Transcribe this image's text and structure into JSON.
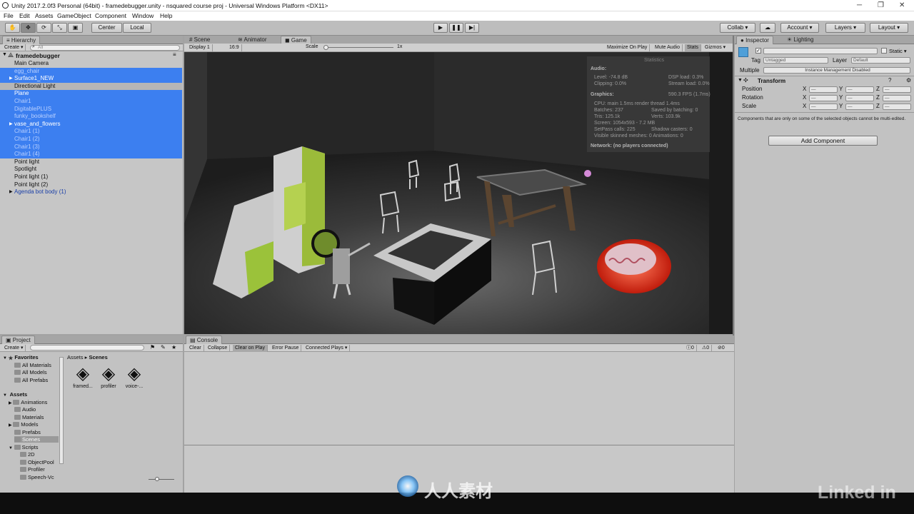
{
  "window": {
    "title": "Unity 2017.2.0f3 Personal (64bit) - framedebugger.unity - nsquared course proj - Universal Windows Platform <DX11>"
  },
  "menu": [
    "File",
    "Edit",
    "Assets",
    "GameObject",
    "Component",
    "Window",
    "Help"
  ],
  "toolbar": {
    "center": "Center",
    "local": "Local",
    "collab": "Collab ▾",
    "account": "Account ▾",
    "layers": "Layers ▾",
    "layout": "Layout ▾"
  },
  "hierarchy": {
    "tab": "Hierarchy",
    "create": "Create ▾",
    "search_placeholder": "All",
    "scene": "framedebugger",
    "items": [
      {
        "label": "Main Camera",
        "state": "plain",
        "arrow": ""
      },
      {
        "label": "egg_chair",
        "state": "sel-dim",
        "arrow": ""
      },
      {
        "label": "Surface1_NEW",
        "state": "sel",
        "arrow": "▶"
      },
      {
        "label": "Directional Light",
        "state": "gray",
        "arrow": ""
      },
      {
        "label": "Plane",
        "state": "sel",
        "arrow": ""
      },
      {
        "label": "Chair1",
        "state": "sel-dim",
        "arrow": ""
      },
      {
        "label": "DigitablePLUS",
        "state": "sel-dim",
        "arrow": ""
      },
      {
        "label": "funky_bookshelf",
        "state": "sel-dim",
        "arrow": ""
      },
      {
        "label": "vase_and_flowers",
        "state": "sel",
        "arrow": "▶"
      },
      {
        "label": "Chair1 (1)",
        "state": "sel-dim",
        "arrow": ""
      },
      {
        "label": "Chair1 (2)",
        "state": "sel-dim",
        "arrow": ""
      },
      {
        "label": "Chair1 (3)",
        "state": "sel-dim",
        "arrow": ""
      },
      {
        "label": "Chair1 (4)",
        "state": "sel-dim",
        "arrow": ""
      },
      {
        "label": "Point light",
        "state": "plain",
        "arrow": ""
      },
      {
        "label": "Spotlight",
        "state": "plain",
        "arrow": ""
      },
      {
        "label": "Point light (1)",
        "state": "plain",
        "arrow": ""
      },
      {
        "label": "Point light (2)",
        "state": "plain",
        "arrow": ""
      },
      {
        "label": "Agenda bot body (1)",
        "state": "plain-blue",
        "arrow": "▶"
      }
    ]
  },
  "views": {
    "tabs": [
      "Scene",
      "Animator",
      "Game"
    ],
    "display": "Display 1",
    "aspect": "16:9",
    "scale_label": "Scale",
    "scale_value": "1x",
    "maximize": "Maximize On Play",
    "mute": "Mute Audio",
    "stats": "Stats",
    "gizmos": "Gizmos ▾"
  },
  "statistics": {
    "title": "Statistics",
    "audio_h": "Audio:",
    "level": "Level: -74.8 dB",
    "dsp": "DSP load: 0.3%",
    "clipping": "Clipping: 0.0%",
    "stream": "Stream load: 0.0%",
    "graphics_h": "Graphics:",
    "fps": "590.3 FPS (1.7ms)",
    "cpu": "CPU: main 1.5ms  render thread 1.4ms",
    "batches": "Batches: 237",
    "saved": "Saved by batching: 0",
    "tris": "Tris: 125.1k",
    "verts": "Verts: 103.9k",
    "screen": "Screen: 1054x593 - 7.2 MB",
    "setpass": "SetPass calls: 225",
    "shadow": "Shadow casters: 0",
    "skinned": "Visible skinned meshes: 0  Animations: 0",
    "network": "Network: (no players connected)"
  },
  "inspector": {
    "tabs": [
      "Inspector",
      "Lighting"
    ],
    "static": "Static ▾",
    "tag_label": "Tag",
    "tag_value": "Untagged",
    "layer_label": "Layer",
    "layer_value": "Default",
    "multiple_label": "Multiple",
    "instance_mgmt": "Instance Management Disabled",
    "transform_h": "Transform",
    "rows": [
      "Position",
      "Rotation",
      "Scale"
    ],
    "axis_x": "X",
    "axis_y": "Y",
    "axis_z": "Z",
    "dash": "—",
    "note": "Components that are only on some of the selected objects cannot be multi-edited.",
    "add_component": "Add Component"
  },
  "project": {
    "tab": "Project",
    "create": "Create ▾",
    "favorites_h": "Favorites",
    "favorites": [
      "All Materials",
      "All Models",
      "All Prefabs"
    ],
    "assets_h": "Assets",
    "folders": [
      "Animations",
      "Audio",
      "Materials",
      "Models",
      "Prefabs",
      "Scenes",
      "Scripts",
      "2D",
      "ObjectPool",
      "Profiler",
      "Speech-Vc"
    ],
    "crumb_root": "Assets",
    "crumb_leaf": "Scenes",
    "scene_files": [
      "framed...",
      "profiler",
      "voice-..."
    ]
  },
  "console": {
    "tab": "Console",
    "buttons": [
      "Clear",
      "Collapse",
      "Clear on Play",
      "Error Pause",
      "Connected Plays ▾"
    ],
    "count_info": "0",
    "count_warn": "0",
    "count_err": "0"
  },
  "watermark": {
    "brand": "人人素材",
    "linkedin": "Linked in"
  }
}
